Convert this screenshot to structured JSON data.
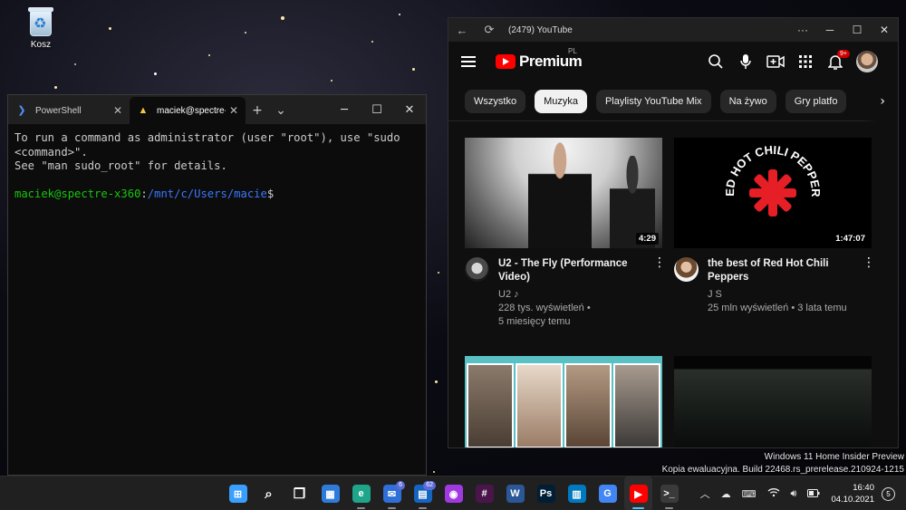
{
  "desktop": {
    "recycle_bin_label": "Kosz"
  },
  "terminal": {
    "tabs": [
      {
        "label": "PowerShell",
        "icon": "powershell-icon"
      },
      {
        "label": "maciek@spectre-",
        "icon": "linux-icon"
      }
    ],
    "lines": [
      "To run a command as administrator (user \"root\"), use \"sudo",
      "<command>\".",
      "See \"man sudo_root\" for details."
    ],
    "prompt_user": "maciek@spectre-x360",
    "prompt_sep": ":",
    "prompt_path": "/mnt/c/Users/macie",
    "prompt_end": "$",
    "colors": {
      "user": "#16c60c",
      "path": "#3b78ff"
    }
  },
  "youtube": {
    "window_title": "(2479) YouTube",
    "logo_text": "Premium",
    "logo_region": "PL",
    "notification_count": "9+",
    "chips": [
      "Wszystko",
      "Muzyka",
      "Playlisty YouTube Mix",
      "Na żywo",
      "Gry platfo"
    ],
    "active_chip": "Muzyka",
    "videos": [
      {
        "title": "U2 - The Fly (Performance Video)",
        "channel": "U2 ♪",
        "views": "228 tys. wyświetleń •",
        "age": "5 miesięcy temu",
        "duration": "4:29"
      },
      {
        "title": "the best of Red Hot Chili Peppers",
        "channel": "J S",
        "views": "25 mln wyświetleń • 3 lata temu",
        "age": "",
        "duration": "1:47:07"
      }
    ],
    "thumbnail_text": {
      "rhcp": "RED HOT CHILI PEPPERS"
    }
  },
  "watermark": {
    "line1": "Windows 11 Home Insider Preview",
    "line2": "Kopia ewaluacyjna. Build 22468.rs_prerelease.210924-1215"
  },
  "taskbar": {
    "apps": [
      {
        "name": "start",
        "glyph": "⊞",
        "color": "#3aa0ff",
        "badge": ""
      },
      {
        "name": "search",
        "glyph": "⌕",
        "color": "transparent",
        "badge": ""
      },
      {
        "name": "task-view",
        "glyph": "❐",
        "color": "transparent",
        "badge": ""
      },
      {
        "name": "widgets",
        "glyph": "▦",
        "color": "#2f7bd9",
        "badge": ""
      },
      {
        "name": "edge-can",
        "glyph": "e",
        "color": "#1fa58a",
        "badge": ""
      },
      {
        "name": "mail",
        "glyph": "✉",
        "color": "#2f6fd8",
        "badge": "6"
      },
      {
        "name": "outlook",
        "glyph": "▤",
        "color": "#1565c0",
        "badge": "62"
      },
      {
        "name": "messenger",
        "glyph": "◉",
        "color": "#a03ae0",
        "badge": ""
      },
      {
        "name": "slack",
        "glyph": "#",
        "color": "#4a154b",
        "badge": ""
      },
      {
        "name": "word",
        "glyph": "W",
        "color": "#2b5797",
        "badge": ""
      },
      {
        "name": "photoshop",
        "glyph": "Ps",
        "color": "#001e36",
        "badge": ""
      },
      {
        "name": "trello",
        "glyph": "▥",
        "color": "#0079bf",
        "badge": ""
      },
      {
        "name": "translate",
        "glyph": "G",
        "color": "#4285f4",
        "badge": ""
      },
      {
        "name": "youtube",
        "glyph": "▶",
        "color": "#ff0000",
        "badge": ""
      },
      {
        "name": "terminal",
        "glyph": ">_",
        "color": "#3a3a3a",
        "badge": ""
      }
    ],
    "time": "16:40",
    "date": "04.10.2021",
    "notification_count": "5"
  }
}
